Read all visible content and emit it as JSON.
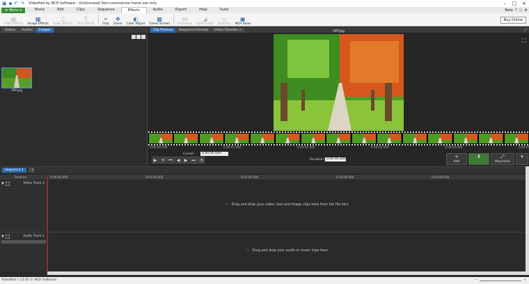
{
  "titlebar": {
    "title": "VideoPad by NCH Software - (Unlicensed) Non-commercial home use only"
  },
  "menubar": {
    "menu_label": "Menu",
    "tabs": [
      "Home",
      "Edit",
      "Clips",
      "Sequence",
      "Effects",
      "Audio",
      "Export",
      "Help",
      "Suite"
    ],
    "active_tab": "Effects",
    "beta_label": "Beta"
  },
  "toolbar": {
    "buttons": [
      {
        "label": "Video Effects",
        "icon": "video-effects-icon",
        "enabled": false
      },
      {
        "label": "Image Effects",
        "icon": "image-effects-icon",
        "enabled": true
      },
      {
        "label": "Audio Effects",
        "icon": "audio-effects-icon",
        "enabled": false
      },
      {
        "label": "Text Effects",
        "icon": "text-effects-icon",
        "enabled": false
      },
      {
        "label": "Crop",
        "icon": "crop-icon",
        "enabled": true
      },
      {
        "label": "Zoom",
        "icon": "zoom-icon",
        "enabled": true
      },
      {
        "label": "Color Adjust",
        "icon": "color-adjust-icon",
        "enabled": true
      },
      {
        "label": "Green Screen",
        "icon": "green-screen-icon",
        "enabled": true
      },
      {
        "label": "Transition",
        "icon": "transition-icon",
        "enabled": false
      },
      {
        "label": "Fade Audio",
        "icon": "fade-audio-icon",
        "enabled": false
      },
      {
        "label": "Subtitles",
        "icon": "subtitles-icon",
        "enabled": false
      },
      {
        "label": "NCH Suite",
        "icon": "nch-suite-icon",
        "enabled": true
      }
    ],
    "buy_online": "Buy Online"
  },
  "bin": {
    "tabs": [
      "Videos",
      "Audios",
      "Images"
    ],
    "active_tab": "Images",
    "clip_name": "OIP.jpg"
  },
  "preview": {
    "tabs": [
      "Clip Preview",
      "Sequence Preview",
      "Video Tutorials"
    ],
    "active_tab": "Clip Preview",
    "title": "OIP.jpg",
    "ticks": [
      "0:00:00.000",
      "0:00:01.000",
      "0:00:02.000",
      "0:00:03.000",
      "0:00:04.000",
      "0:00:05.000"
    ],
    "cursor_label": "Cursor:",
    "cursor_value": "0:00:00.000",
    "duration_label": "Duration:",
    "duration_value": "0:00:05.000",
    "add_label": "Add",
    "snapshot_label": "Add to sequence",
    "maximize_label": "Maximize"
  },
  "timeline": {
    "sequence_tab": "Sequence 1",
    "ruler_label": "Timeline",
    "ruler_ticks": [
      "0:00:00.000",
      "0:01:00.000",
      "0:02:00.000",
      "0:03:00.000",
      "0:04:00.000",
      "0:05:00.000"
    ],
    "video_track": "Video Track 1",
    "audio_track": "Audio Track 1",
    "video_hint": "Drag and drop your video, text and image clips here from the file bins",
    "audio_hint": "Drag and drop your audio or music clips here"
  },
  "status": {
    "text": "VideoPad v 13.45 © NCH Software"
  },
  "colors": {
    "accent": "#2f6db3",
    "menu_green": "#3a8a3a",
    "playhead": "#d02020"
  }
}
